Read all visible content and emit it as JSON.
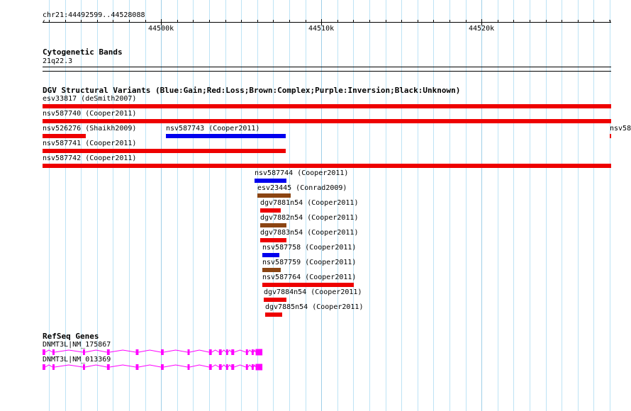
{
  "colors": {
    "gain": "#0000ee",
    "loss": "#ee0000",
    "complex": "#8b4513",
    "gene": "#ff00ff",
    "grid": "#bde3f5"
  },
  "ruler": {
    "range_label": "chr21:44492599..44528088",
    "start": 44492599,
    "end": 44528088,
    "ticks": [
      {
        "pos": 44500000,
        "label": "44500k"
      },
      {
        "pos": 44510000,
        "label": "44510k"
      },
      {
        "pos": 44520000,
        "label": "44520k"
      }
    ]
  },
  "cytoband": {
    "title": "Cytogenetic Bands",
    "band": "21q22.3"
  },
  "dgv": {
    "title": "DGV Structural Variants (Blue:Gain;Red:Loss;Brown:Complex;Purple:Inversion;Black:Unknown)",
    "variants": [
      {
        "label": "esv33817 (deSmith2007)",
        "type": "loss",
        "start": 44492599,
        "end": 44528088,
        "row": 0,
        "label_start": 44492599
      },
      {
        "label": "nsv587740 (Cooper2011)",
        "type": "loss",
        "start": 44492599,
        "end": 44528088,
        "row": 1,
        "label_start": 44492599
      },
      {
        "label": "nsv526276 (Shaikh2009)",
        "type": "loss",
        "start": 44492599,
        "end": 44495300,
        "row": 2,
        "label_start": 44492599
      },
      {
        "label": "nsv587743 (Cooper2011)",
        "type": "gain",
        "start": 44500300,
        "end": 44507780,
        "row": 2,
        "label_start": 44500300
      },
      {
        "label": "nsv58",
        "type": "loss",
        "start": 44527990,
        "end": 44528088,
        "row": 2,
        "label_start": 44527990
      },
      {
        "label": "nsv587741 (Cooper2011)",
        "type": "loss",
        "start": 44492599,
        "end": 44507780,
        "row": 3,
        "label_start": 44492599
      },
      {
        "label": "nsv587742 (Cooper2011)",
        "type": "loss",
        "start": 44492599,
        "end": 44528088,
        "row": 4,
        "label_start": 44492599
      },
      {
        "label": "nsv587744 (Cooper2011)",
        "type": "gain",
        "start": 44505830,
        "end": 44507800,
        "row": 5,
        "label_start": 44505830
      },
      {
        "label": "esv23445 (Conrad2009)",
        "type": "complex",
        "start": 44506010,
        "end": 44508080,
        "row": 6,
        "label_start": 44506010
      },
      {
        "label": "dgv7881n54 (Cooper2011)",
        "type": "loss",
        "start": 44506190,
        "end": 44507450,
        "row": 7,
        "label_start": 44506190
      },
      {
        "label": "dgv7882n54 (Cooper2011)",
        "type": "complex",
        "start": 44506190,
        "end": 44507800,
        "row": 8,
        "label_start": 44506190
      },
      {
        "label": "dgv7883n54 (Cooper2011)",
        "type": "loss",
        "start": 44506190,
        "end": 44507800,
        "row": 9,
        "label_start": 44506190
      },
      {
        "label": "nsv587758 (Cooper2011)",
        "type": "gain",
        "start": 44506320,
        "end": 44507360,
        "row": 10,
        "label_start": 44506320
      },
      {
        "label": "nsv587759 (Cooper2011)",
        "type": "complex",
        "start": 44506320,
        "end": 44507450,
        "row": 11,
        "label_start": 44506320
      },
      {
        "label": "nsv587764 (Cooper2011)",
        "type": "loss",
        "start": 44506320,
        "end": 44512010,
        "row": 12,
        "label_start": 44506320
      },
      {
        "label": "dgv7884n54 (Cooper2011)",
        "type": "loss",
        "start": 44506410,
        "end": 44507800,
        "row": 13,
        "label_start": 44506410
      },
      {
        "label": "dgv7885n54 (Cooper2011)",
        "type": "loss",
        "start": 44506500,
        "end": 44507540,
        "row": 14,
        "label_start": 44506500
      }
    ]
  },
  "genes": {
    "title": "RefSeq Genes",
    "transcripts": [
      {
        "label": "DNMT3L|NM_175867",
        "start": 44492599,
        "end": 44506320,
        "exons": [
          [
            44492599,
            44492770
          ],
          [
            44493220,
            44493350
          ],
          [
            44495120,
            44495250
          ],
          [
            44496620,
            44496790
          ],
          [
            44498420,
            44498590
          ],
          [
            44499990,
            44500160
          ],
          [
            44501650,
            44501780
          ],
          [
            44502990,
            44503160
          ],
          [
            44503610,
            44503780
          ],
          [
            44504060,
            44504180
          ],
          [
            44504380,
            44504560
          ],
          [
            44505290,
            44505420
          ],
          [
            44505650,
            44505780
          ],
          [
            44505900,
            44506320
          ]
        ]
      },
      {
        "label": "DNMT3L|NM_013369",
        "start": 44492599,
        "end": 44506320,
        "exons": [
          [
            44492599,
            44492770
          ],
          [
            44493220,
            44493350
          ],
          [
            44495120,
            44495250
          ],
          [
            44496620,
            44496790
          ],
          [
            44498420,
            44498590
          ],
          [
            44499990,
            44500160
          ],
          [
            44501650,
            44501780
          ],
          [
            44502990,
            44503160
          ],
          [
            44503610,
            44503780
          ],
          [
            44504060,
            44504180
          ],
          [
            44504380,
            44504560
          ],
          [
            44505290,
            44505420
          ],
          [
            44505650,
            44505780
          ],
          [
            44505900,
            44506320
          ]
        ]
      }
    ]
  }
}
